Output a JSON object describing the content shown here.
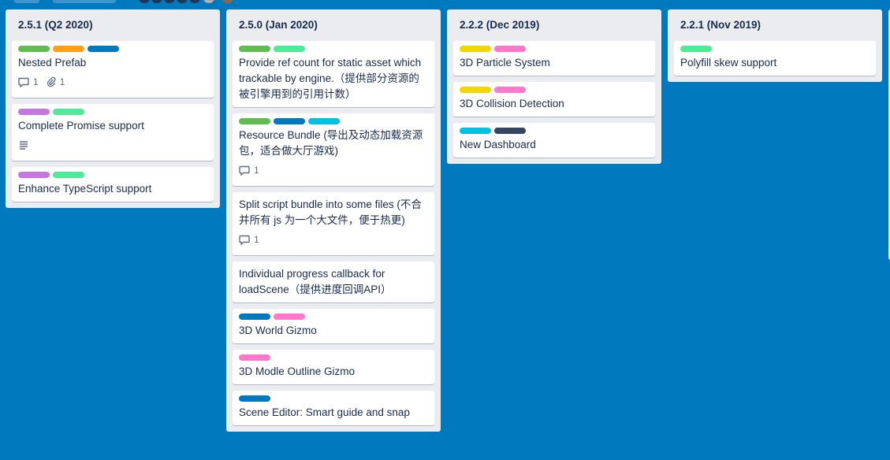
{
  "colors": {
    "green": "#61bd4f",
    "orange": "#ff9f1a",
    "blue": "#0079bf",
    "purple": "#c377e0",
    "lime": "#51e898",
    "yellow": "#f2d600",
    "pink": "#ff78cb",
    "sky": "#00c2e0",
    "black": "#344563"
  },
  "lists": [
    {
      "title": "2.5.1 (Q2 2020)",
      "cards": [
        {
          "labels": [
            "green",
            "orange",
            "blue"
          ],
          "title": "Nested Prefab",
          "comments": "1",
          "attachments": "1"
        },
        {
          "labels": [
            "purple",
            "lime"
          ],
          "title": "Complete Promise support",
          "description": true
        },
        {
          "labels": [
            "purple",
            "lime"
          ],
          "title": "Enhance TypeScript support"
        }
      ]
    },
    {
      "title": "2.5.0 (Jan 2020)",
      "cards": [
        {
          "labels": [
            "green",
            "lime"
          ],
          "title": "Provide ref count for static asset which trackable by engine.（提供部分资源的被引擎用到的引用计数）"
        },
        {
          "labels": [
            "green",
            "blue",
            "sky"
          ],
          "title": "Resource Bundle (导出及动态加载资源包，适合做大厅游戏)",
          "comments": "1"
        },
        {
          "labels": [],
          "title": "Split script bundle into some files (不合并所有 js 为一个大文件，便于热更)",
          "comments": "1"
        },
        {
          "labels": [],
          "title": "Individual progress callback for loadScene（提供进度回调API）"
        },
        {
          "labels": [
            "blue",
            "pink"
          ],
          "title": "3D World Gizmo"
        },
        {
          "labels": [
            "pink"
          ],
          "title": "3D Modle Outline Gizmo"
        },
        {
          "labels": [
            "blue"
          ],
          "title": "Scene Editor: Smart guide and snap"
        }
      ]
    },
    {
      "title": "2.2.2 (Dec 2019)",
      "cards": [
        {
          "labels": [
            "yellow",
            "pink"
          ],
          "title": "3D Particle System"
        },
        {
          "labels": [
            "yellow",
            "pink"
          ],
          "title": "3D Collision Detection"
        },
        {
          "labels": [
            "sky",
            "black"
          ],
          "title": "New Dashboard"
        }
      ]
    },
    {
      "title": "2.2.1 (Nov 2019)",
      "cards": [
        {
          "labels": [
            "lime"
          ],
          "title": "Polyfill skew support"
        }
      ]
    }
  ]
}
